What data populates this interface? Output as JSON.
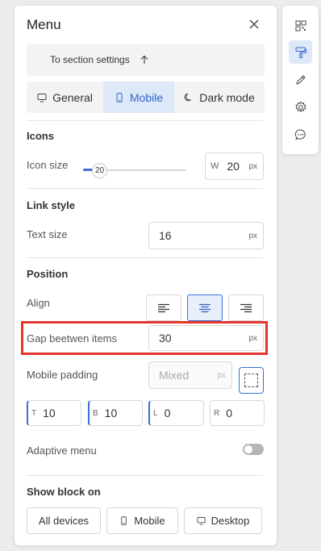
{
  "panel": {
    "title": "Menu",
    "section_link": "To section settings",
    "tabs": [
      {
        "label": "General",
        "icon": "monitor-icon"
      },
      {
        "label": "Mobile",
        "icon": "mobile-icon"
      },
      {
        "label": "Dark mode",
        "icon": "moon-icon"
      }
    ],
    "active_tab": "Mobile",
    "icons": {
      "heading": "Icons",
      "size_label": "Icon size",
      "slider_value": "20",
      "slider_fraction": 0.12,
      "width_prefix": "W",
      "width_value": "20",
      "width_unit": "px"
    },
    "link_style": {
      "heading": "Link style",
      "text_size_label": "Text size",
      "text_size_value": "16",
      "text_size_unit": "px"
    },
    "position": {
      "heading": "Position",
      "align_label": "Align",
      "align_selected": "center",
      "gap_label": "Gap beetwen items",
      "gap_value": "30",
      "gap_unit": "px",
      "padding_label": "Mobile padding",
      "padding_placeholder": "Mixed",
      "padding_unit": "px",
      "padding": [
        {
          "side": "T",
          "value": "10"
        },
        {
          "side": "B",
          "value": "10"
        },
        {
          "side": "L",
          "value": "0"
        },
        {
          "side": "R",
          "value": "0"
        }
      ],
      "adaptive_label": "Adaptive menu",
      "adaptive_on": false
    },
    "show_block": {
      "heading": "Show block on",
      "options": [
        {
          "label": "All devices"
        },
        {
          "label": "Mobile",
          "icon": "mobile-icon"
        },
        {
          "label": "Desktop",
          "icon": "monitor-icon"
        }
      ]
    }
  },
  "sidebar": {
    "items": [
      {
        "icon": "qr-code-icon"
      },
      {
        "icon": "paint-roller-icon",
        "active": true
      },
      {
        "icon": "pencil-icon"
      },
      {
        "icon": "gear-icon"
      },
      {
        "icon": "chat-icon"
      }
    ]
  },
  "colors": {
    "accent": "#3a6fd8",
    "active_tab_bg": "#dde8f9",
    "highlight_border": "#e4362b"
  }
}
